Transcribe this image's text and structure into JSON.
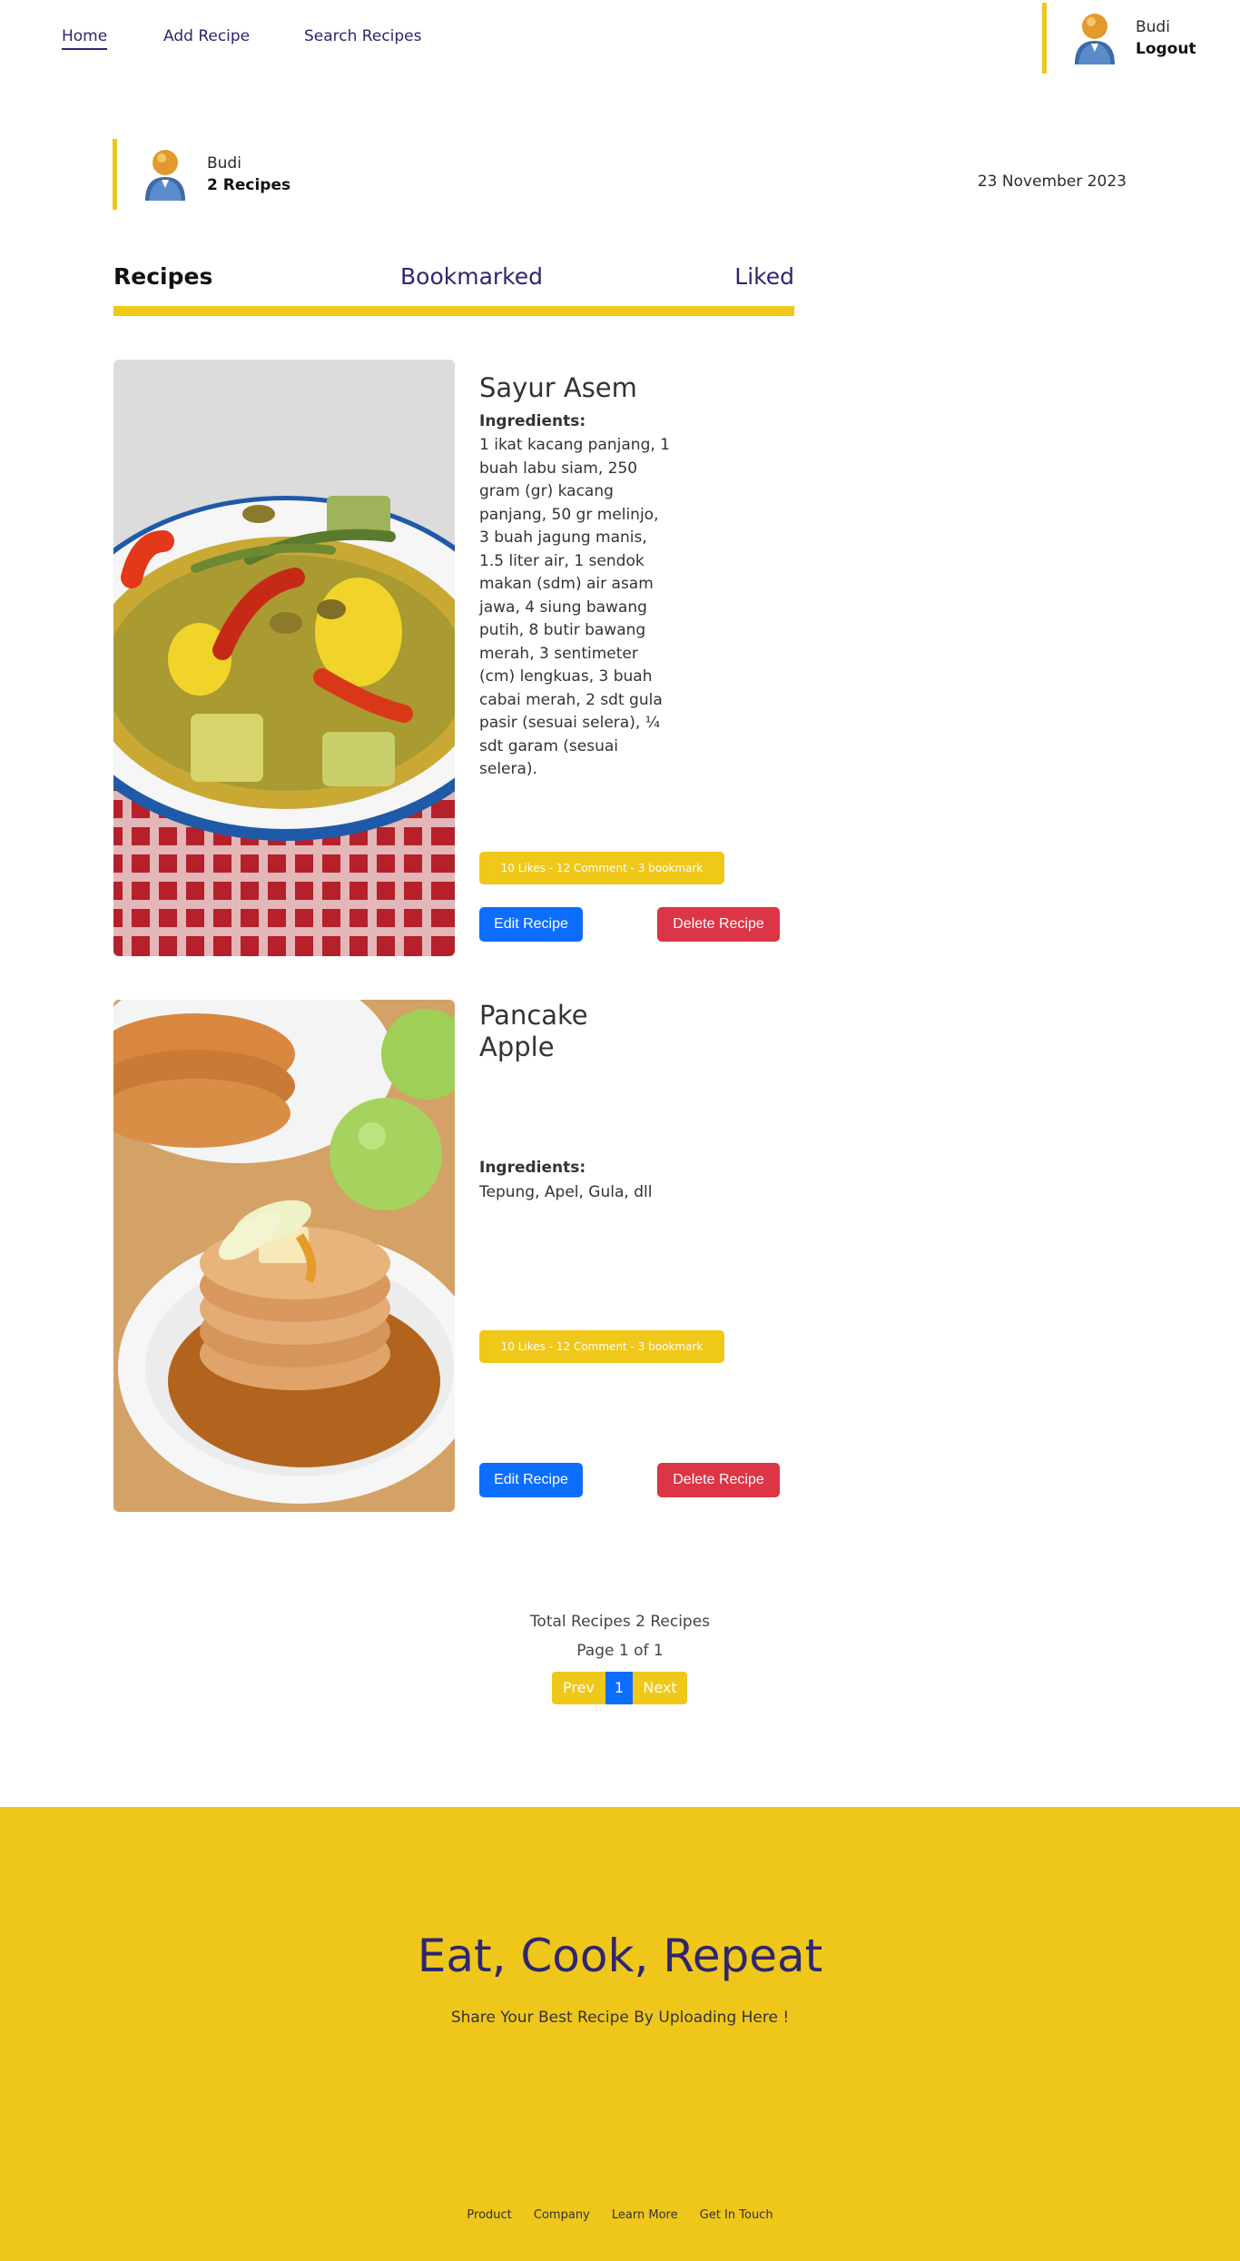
{
  "nav": {
    "home": "Home",
    "add_recipe": "Add Recipe",
    "search_recipes": "Search Recipes",
    "user_name": "Budi",
    "logout": "Logout"
  },
  "profile": {
    "name": "Budi",
    "recipe_count": "2 Recipes",
    "date": "23 November 2023"
  },
  "tabs": [
    "Recipes",
    "Bookmarked",
    "Liked"
  ],
  "recipes": [
    {
      "title": "Sayur Asem",
      "ingredients_label": "Ingredients:",
      "ingredients": "1 ikat kacang panjang, 1 buah labu siam, 250 gram (gr) kacang panjang, 50 gr melinjo, 3 buah jagung manis, 1.5 liter air, 1 sendok makan (sdm) air asam jawa, 4 siung bawang putih, 8 butir bawang merah, 3 sentimeter (cm) lengkuas, 3 buah cabai merah, 2 sdt gula pasir (sesuai selera), ¼ sdt garam (sesuai selera).",
      "stats": "10 Likes - 12 Comment - 3 bookmark",
      "edit_label": "Edit Recipe",
      "delete_label": "Delete Recipe"
    },
    {
      "title": "Pancake Apple",
      "ingredients_label": "Ingredients:",
      "ingredients": "Tepung, Apel, Gula, dll",
      "stats": "10 Likes - 12 Comment - 3 bookmark",
      "edit_label": "Edit Recipe",
      "delete_label": "Delete Recipe"
    }
  ],
  "pagination": {
    "total": "Total Recipes 2 Recipes",
    "page": "Page 1 of 1",
    "prev": "Prev",
    "current": "1",
    "next": "Next"
  },
  "footer": {
    "slogan": "Eat, Cook, Repeat",
    "subtitle": "Share Your Best Recipe By Uploading Here !",
    "links": [
      "Product",
      "Company",
      "Learn More",
      "Get In Touch"
    ]
  },
  "colors": {
    "accent": "#efc81a",
    "primary": "#2e266f",
    "edit": "#0d6efd",
    "delete": "#dc3545"
  }
}
